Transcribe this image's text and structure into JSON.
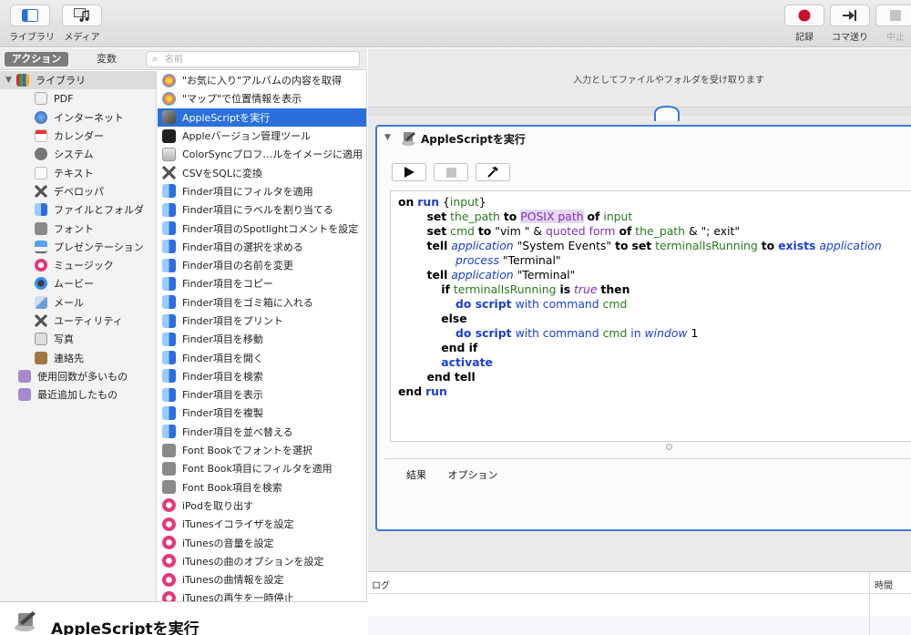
{
  "toolbar": {
    "library_label": "ライブラリ",
    "media_label": "メディア",
    "record_label": "記録",
    "step_label": "コマ送り",
    "stop_label": "中止"
  },
  "left_header": {
    "actions_tab": "アクション",
    "variables_tab": "変数",
    "search_placeholder": "名前"
  },
  "library": {
    "root": "ライブラリ",
    "items": [
      "PDF",
      "インターネット",
      "カレンダー",
      "システム",
      "テキスト",
      "デベロッパ",
      "ファイルとフォルダ",
      "フォント",
      "プレゼンテーション",
      "ミュージック",
      "ムービー",
      "メール",
      "ユーティリティ",
      "写真",
      "連絡先"
    ],
    "smart": [
      "使用回数が多いもの",
      "最近追加したもの"
    ]
  },
  "actions": {
    "items": [
      "\"お気に入り\"アルバムの内容を取得",
      "\"マップ\"で位置情報を表示",
      "AppleScriptを実行",
      "Appleバージョン管理ツール",
      "ColorSyncプロフ…ルをイメージに適用",
      "CSVをSQLに変換",
      "Finder項目にフィルタを適用",
      "Finder項目にラベルを割り当てる",
      "Finder項目のSpotlightコメントを設定",
      "Finder項目の選択を求める",
      "Finder項目の名前を変更",
      "Finder項目をコピー",
      "Finder項目をゴミ箱に入れる",
      "Finder項目をプリント",
      "Finder項目を移動",
      "Finder項目を開く",
      "Finder項目を検索",
      "Finder項目を表示",
      "Finder項目を複製",
      "Finder項目を並べ替える",
      "Font Bookでフォントを選択",
      "Font Book項目にフィルタを適用",
      "Font Book項目を検索",
      "iPodを取り出す",
      "iTunesイコライザを設定",
      "iTunesの音量を設定",
      "iTunesの曲のオプションを設定",
      "iTunesの曲情報を設定",
      "iTunesの再生を一時停止"
    ],
    "selected_index": 2
  },
  "description": {
    "title": "AppleScriptを実行"
  },
  "workflow": {
    "input_note": "入力としてファイルやフォルダを受け取ります",
    "card_title": "AppleScriptを実行",
    "tab_results": "結果",
    "tab_options": "オプション"
  },
  "code": {
    "l1": [
      "on",
      "run",
      "{",
      "input",
      "}"
    ],
    "l2": [
      "set",
      "the_path",
      "to",
      "POSIX path",
      "of",
      "input"
    ],
    "l3": [
      "set",
      "cmd",
      "to",
      "\"vim \" & ",
      "quoted form",
      "of",
      "the_path",
      " & \"; exit\""
    ],
    "l4": [
      "tell",
      "application",
      "\"System Events\"",
      "to",
      "set",
      "terminalIsRunning",
      "to",
      "exists",
      "application"
    ],
    "l5": [
      "process",
      "\"Terminal\""
    ],
    "l6": [
      "tell",
      "application",
      "\"Terminal\""
    ],
    "l7": [
      "if",
      "terminalIsRunning",
      "is",
      "true",
      "then"
    ],
    "l8": [
      "do script",
      "with command",
      "cmd"
    ],
    "l9": [
      "else"
    ],
    "l10": [
      "do script",
      "with command",
      "cmd",
      "in",
      "window",
      "1"
    ],
    "l11": [
      "end if"
    ],
    "l12": [
      "activate"
    ],
    "l13": [
      "end tell"
    ],
    "l14": [
      "end",
      "run"
    ]
  },
  "log": {
    "col_log": "ログ",
    "col_time": "時間"
  },
  "colors": {
    "selection": "#2a6fdb",
    "card_border": "#3c79d6",
    "keyword_blue": "#1a3fd1",
    "variable_green": "#287a1d",
    "property_purple": "#8230b8"
  }
}
